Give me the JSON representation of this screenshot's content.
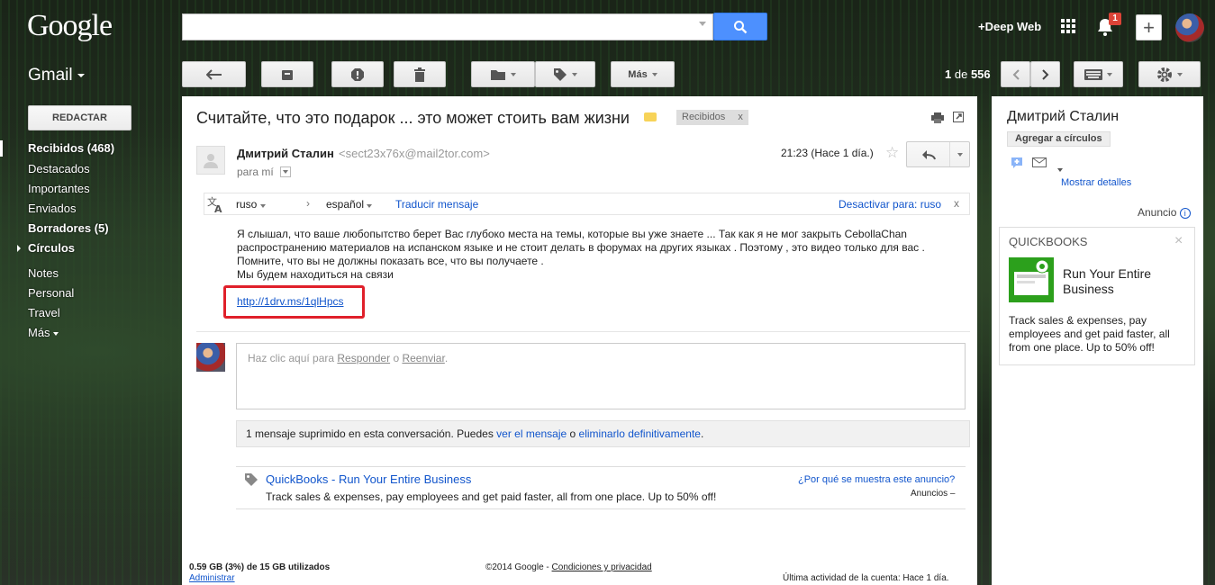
{
  "header": {
    "logo": "Google",
    "search_value": "",
    "user_link": "+Deep Web",
    "notification_count": "1"
  },
  "toolbar": {
    "app_label": "Gmail",
    "more_label": "Más",
    "pager_range": "1",
    "pager_of": "de",
    "pager_total": "556"
  },
  "nav": {
    "compose": "REDACTAR",
    "items": [
      {
        "label": "Recibidos (468)"
      },
      {
        "label": "Destacados"
      },
      {
        "label": "Importantes"
      },
      {
        "label": "Enviados"
      },
      {
        "label": "Borradores (5)"
      },
      {
        "label": "Círculos"
      },
      {
        "label": "Notes"
      },
      {
        "label": "Personal"
      },
      {
        "label": "Travel"
      },
      {
        "label": "Más"
      }
    ]
  },
  "email": {
    "subject": "Считайте, что это подарок ... это может стоить вам жизни",
    "label": "Recibidos",
    "label_remove": "x",
    "sender_name": "Дмитрий Сталин",
    "sender_email": "<sect23x76x@mail2tor.com>",
    "to": "para mí",
    "time": "21:23 (Hace 1 día.)",
    "translate": {
      "from_lang": "ruso",
      "to_lang": "español",
      "translate_action": "Traducir mensaje",
      "disable_action": "Desactivar para: ruso",
      "close": "x"
    },
    "body_lines": [
      "Я слышал, что ваше любопытство берет Вас глубоко места на темы, которые вы уже знаете ... Так как я не мог закрыть CebollaChan распространению материалов на испанском языке и не стоит делать в форумах на других языках . Поэтому , это видео только для вас . Помните, что вы не должны показать все, что вы получаете .",
      "Мы будем находиться на связи"
    ],
    "link": "http://1drv.ms/1qlHpcs"
  },
  "reply": {
    "prefix": "Haz clic aquí para ",
    "reply_link": "Responder",
    "middle": " o ",
    "forward_link": "Reenviar",
    "suffix": "."
  },
  "deleted_notice": {
    "text": "1 mensaje suprimido en esta conversación. Puedes ",
    "view_link": "ver el mensaje",
    "middle": " o ",
    "delete_link": "eliminarlo definitivamente",
    "suffix": "."
  },
  "inline_ad": {
    "advertiser": "QuickBooks",
    "separator": " - ",
    "headline": "Run Your Entire Business",
    "text": "Track sales & expenses, pay employees and get paid faster, all from one place. Up to 50% off!",
    "why": "¿Por qué se muestra este anuncio?",
    "ads_label": "Anuncios –"
  },
  "footer": {
    "quota": "0.59 GB (3%) de 15 GB utilizados",
    "manage": "Administrar",
    "copyright": "©2014 Google - ",
    "terms": "Condiciones y privacidad",
    "activity": "Última actividad de la cuenta: Hace 1 día."
  },
  "sidebar": {
    "contact_name": "Дмитрий Сталин",
    "add_to_circles": "Agregar a círculos",
    "show_details": "Mostrar detalles",
    "ad_label": "Anuncio",
    "ad": {
      "brand": "QUICKBOOKS",
      "close": "×",
      "headline": "Run Your Entire Business",
      "text": "Track sales & expenses, pay employees and get paid faster, all from one place. Up to 50% off!"
    }
  },
  "colors": {
    "accent_blue": "#4d90fe",
    "link": "#1155cc",
    "badge_red": "#db4437",
    "highlight_red": "#e0202a",
    "label_yellow": "#f7d358",
    "quickbooks_green": "#2ca01c"
  },
  "icons": [
    "search-icon",
    "apps-icon",
    "bell-icon",
    "plus-icon",
    "reply-icon",
    "archive-icon",
    "spam-icon",
    "trash-icon",
    "folder-icon",
    "tag-icon",
    "chevron-left-icon",
    "chevron-right-icon",
    "keyboard-icon",
    "gear-icon",
    "print-icon",
    "new-window-icon",
    "star-icon",
    "translate-icon",
    "chat-icon",
    "mail-icon",
    "quickbooks-logo-icon"
  ]
}
